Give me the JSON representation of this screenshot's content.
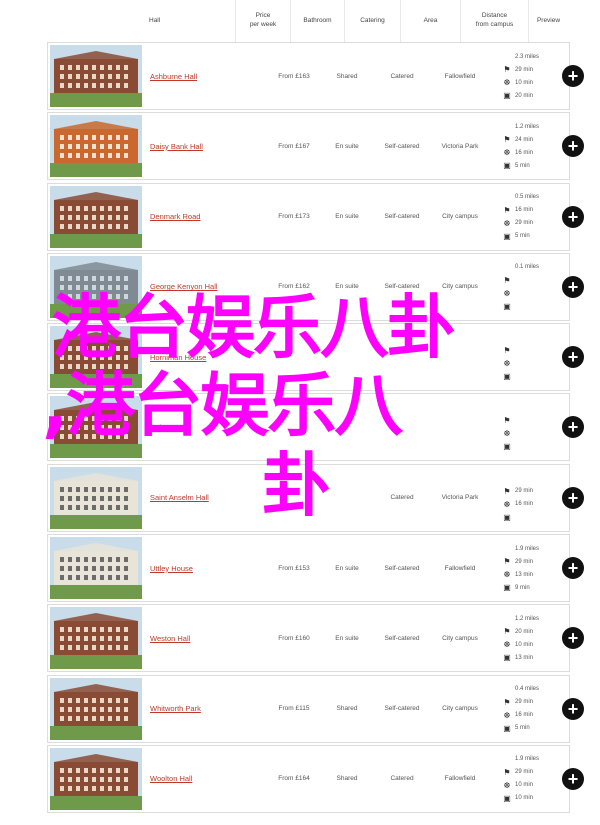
{
  "header": {
    "hall": "Hall",
    "price": "Price\nper week",
    "bathroom": "Bathroom",
    "catering": "Catering",
    "area": "Area",
    "distance": "Distance\nfrom campus",
    "preview": "Preview"
  },
  "rows": [
    {
      "name": "Ashburne Hall",
      "price": "From £163",
      "bathroom": "Shared",
      "catering": "Catered",
      "area": "Fallowfield",
      "dist": "2.3 miles",
      "walk": "29 min",
      "bus": "20 min",
      "bike": "10 min",
      "theme": "brick"
    },
    {
      "name": "Daisy Bank Hall",
      "price": "From £167",
      "bathroom": "En suite",
      "catering": "Self-catered",
      "area": "Victoria Park",
      "dist": "1.2 miles",
      "walk": "24 min",
      "bus": "5 min",
      "bike": "16 min",
      "theme": "orange"
    },
    {
      "name": "Denmark Road",
      "price": "From £173",
      "bathroom": "En suite",
      "catering": "Self-catered",
      "area": "City campus",
      "dist": "0.5 miles",
      "walk": "16 min",
      "bus": "5 min",
      "bike": "29 min",
      "theme": "brick"
    },
    {
      "name": "George Kenyon Hall",
      "price": "From £162",
      "bathroom": "En suite",
      "catering": "Self-catered",
      "area": "City campus",
      "dist": "0.1 miles",
      "walk": "",
      "bus": "",
      "bike": "",
      "theme": "tower"
    },
    {
      "name": "Horniman House",
      "price": "",
      "bathroom": "",
      "catering": "",
      "area": "",
      "dist": "",
      "walk": "",
      "bus": "",
      "bike": "",
      "theme": "brick"
    },
    {
      "name": "Hulme Hall",
      "price": "",
      "bathroom": "",
      "catering": "",
      "area": "",
      "dist": "",
      "walk": "",
      "bus": "",
      "bike": "",
      "theme": "brick"
    },
    {
      "name": "Saint Anselm Hall",
      "price": "",
      "bathroom": "",
      "catering": "Catered",
      "area": "Victoria Park",
      "dist": "",
      "walk": "29 min",
      "bus": "",
      "bike": "16 min",
      "theme": "white"
    },
    {
      "name": "Uttley House",
      "price": "From £153",
      "bathroom": "En suite",
      "catering": "Self-catered",
      "area": "Fallowfield",
      "dist": "1.9 miles",
      "walk": "29 min",
      "bus": "9 min",
      "bike": "13 min",
      "theme": "white"
    },
    {
      "name": "Weston Hall",
      "price": "From £160",
      "bathroom": "En suite",
      "catering": "Self-catered",
      "area": "City campus",
      "dist": "1.2 miles",
      "walk": "20 min",
      "bus": "13 min",
      "bike": "10 min",
      "theme": "brick"
    },
    {
      "name": "Whitworth Park",
      "price": "From £115",
      "bathroom": "Shared",
      "catering": "Self-catered",
      "area": "City campus",
      "dist": "0.4 miles",
      "walk": "29 min",
      "bus": "5 min",
      "bike": "16 min",
      "theme": "brick"
    },
    {
      "name": "Woolton Hall",
      "price": "From £164",
      "bathroom": "Shared",
      "catering": "Catered",
      "area": "Fallowfield",
      "dist": "1.9 miles",
      "walk": "29 min",
      "bus": "10 min",
      "bike": "10 min",
      "theme": "brick"
    }
  ],
  "overlay": {
    "line1": "港台娱乐八卦",
    "line2": ",港台娱乐八",
    "line3": "卦"
  },
  "colors": {
    "link": "#c0392b",
    "overlay": "#ff00ff",
    "button": "#111111"
  },
  "icons": {
    "walk": "walking-icon",
    "bike": "bicycle-icon",
    "bus": "bus-icon",
    "preview": "plus-circle-icon"
  }
}
